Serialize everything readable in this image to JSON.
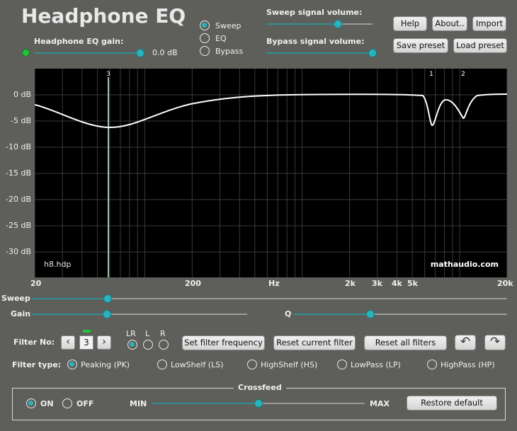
{
  "app": {
    "title": "Headphone EQ"
  },
  "gain": {
    "label": "Headphone EQ gain:",
    "value": "0.0 dB"
  },
  "mode": {
    "options": [
      "Sweep",
      "EQ",
      "Bypass"
    ],
    "selected": "Sweep"
  },
  "sweep_volume": {
    "label": "Sweep signal volume:",
    "level": 0.67
  },
  "bypass_volume": {
    "label": "Bypass signal volume:",
    "level": 1.0
  },
  "buttons": {
    "help": "Help",
    "about": "About..",
    "import": "Import",
    "save_preset": "Save preset",
    "load_preset": "Load preset"
  },
  "graph": {
    "y_ticks": [
      "0 dB",
      "-5 dB",
      "-10 dB",
      "-15 dB",
      "-20 dB",
      "-25 dB",
      "-30 dB"
    ],
    "x_ticks": [
      "20",
      "200",
      "Hz",
      "2k",
      "3k",
      "4k",
      "5k",
      "20k"
    ],
    "file_label": "h8.hdp",
    "watermark": "mathaudio.com",
    "markers": [
      "3",
      "1",
      "2"
    ],
    "accent": "#2bb3bd"
  },
  "controls": {
    "sweep_label": "Sweep",
    "gain_label": "Gain",
    "q_label": "Q",
    "sweep_level": 0.16,
    "gain_level": 0.35,
    "q_level": 0.36
  },
  "filter": {
    "no_label": "Filter No:",
    "number": "3",
    "channels": [
      "LR",
      "L",
      "R"
    ],
    "selected_channel": "LR",
    "set_freq": "Set filter frequency",
    "reset_current": "Reset current filter",
    "reset_all": "Reset all filters",
    "type_label": "Filter type:",
    "types": [
      "Peaking (PK)",
      "LowShelf (LS)",
      "HighShelf (HS)",
      "LowPass (LP)",
      "HighPass (HP)"
    ],
    "selected_type": "Peaking (PK)"
  },
  "crossfeed": {
    "title": "Crossfeed",
    "on": "ON",
    "off": "OFF",
    "selected": "ON",
    "min": "MIN",
    "max": "MAX",
    "level": 0.5,
    "restore": "Restore default"
  }
}
